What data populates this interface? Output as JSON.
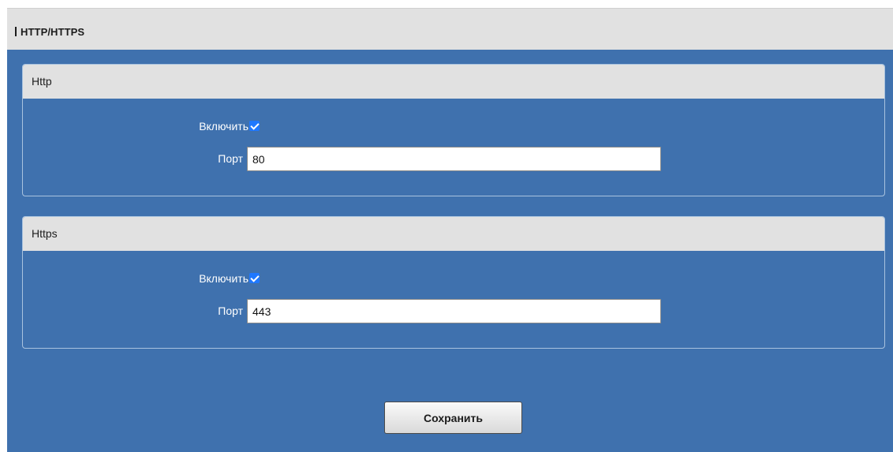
{
  "page": {
    "title": "HTTP/HTTPS"
  },
  "sections": [
    {
      "title": "Http",
      "enable_label": "Включить",
      "enabled": true,
      "port_label": "Порт",
      "port_value": "80"
    },
    {
      "title": "Https",
      "enable_label": "Включить",
      "enabled": true,
      "port_label": "Порт",
      "port_value": "443"
    }
  ],
  "actions": {
    "save_label": "Сохранить"
  },
  "colors": {
    "background": "#3f71ae",
    "header": "#e1e1e1",
    "checkbox_checked": "#1f78ff"
  },
  "icons": {
    "checkbox_checked": "checkmark-icon"
  }
}
